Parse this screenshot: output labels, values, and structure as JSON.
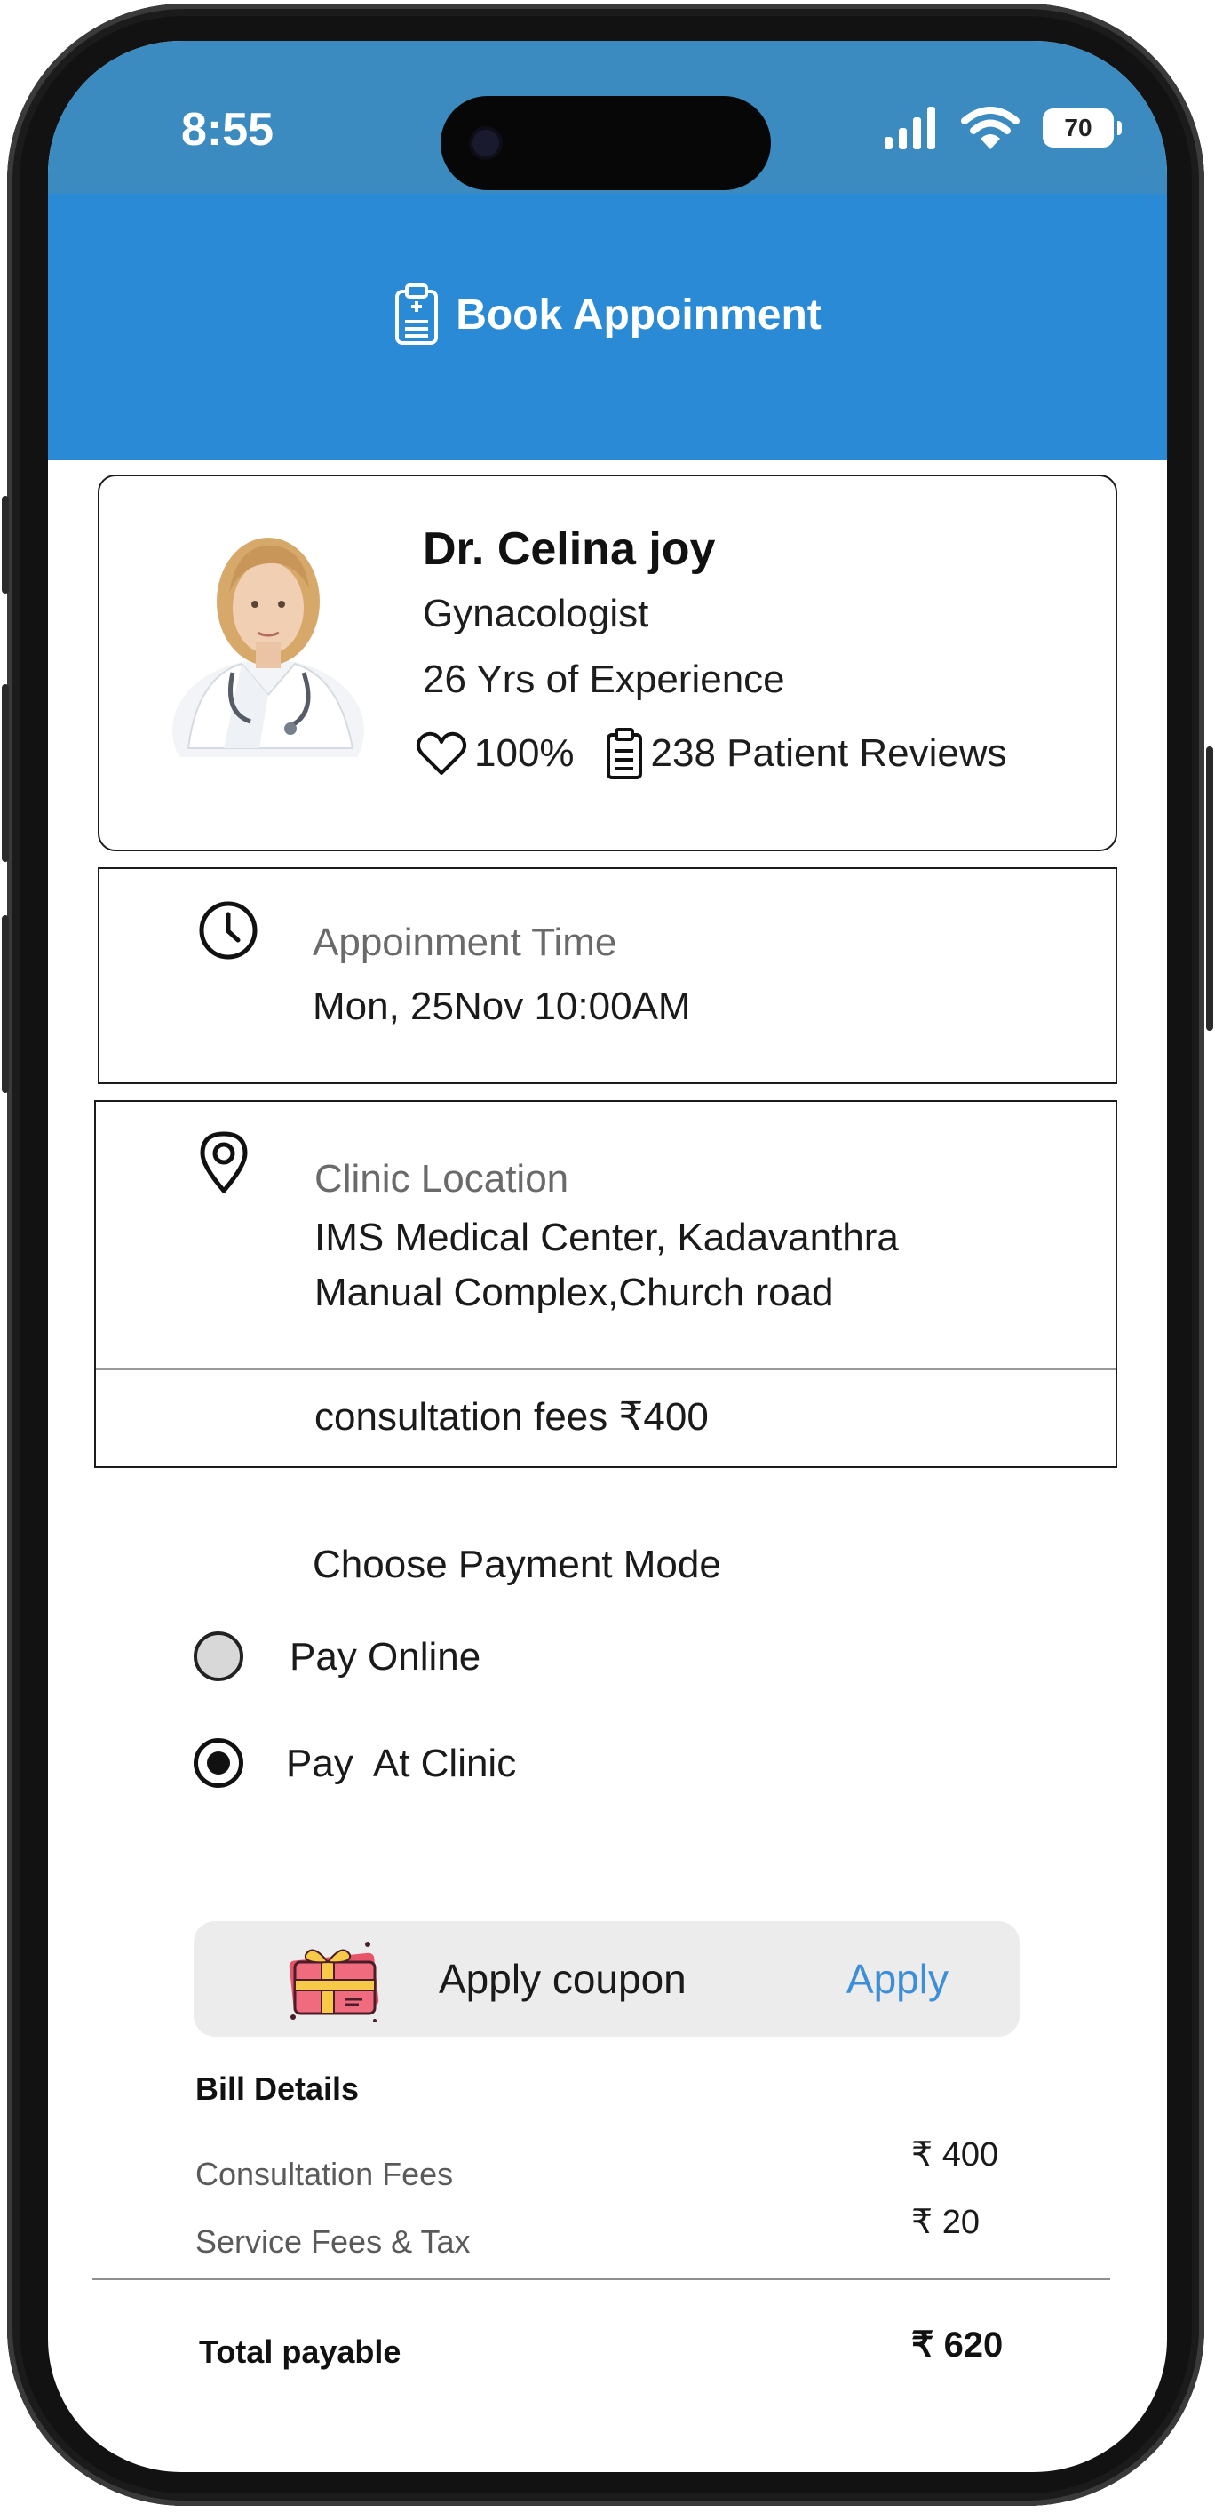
{
  "status": {
    "time": "8:55",
    "battery": "70"
  },
  "header": {
    "title": "Book Appoinment",
    "icon": "clipboard-icon",
    "bg_color": "#2a8ad6"
  },
  "doctor": {
    "name": "Dr. Celina joy",
    "specialty": "Gynacologist",
    "experience": "26 Yrs of Experience",
    "rating": "100%",
    "reviews": "238 Patient Reviews"
  },
  "appointment": {
    "label": "Appoinment Time",
    "value": "Mon, 25Nov 10:00AM",
    "icon": "clock-icon"
  },
  "clinic": {
    "label": "Clinic Location",
    "line1": "IMS Medical Center, Kadavanthra",
    "line2": "Manual Complex,Church road",
    "fees": "consultation fees ₹400",
    "icon": "location-pin-icon"
  },
  "payment": {
    "title": "Choose Payment Mode",
    "options": [
      {
        "label": "Pay Online",
        "selected": false
      },
      {
        "label": "Pay  At Clinic",
        "selected": true
      }
    ]
  },
  "coupon": {
    "label": "Apply coupon",
    "action": "Apply",
    "icon": "coupon-gift-icon",
    "accent": "#3d8ed8"
  },
  "bill": {
    "title": "Bill Details",
    "items": [
      {
        "label": "Consultation Fees",
        "amount": "₹ 400"
      },
      {
        "label": "Service Fees & Tax",
        "amount": "₹ 20"
      }
    ],
    "total_label": "Total payable",
    "total_amount": "₹ 620"
  }
}
